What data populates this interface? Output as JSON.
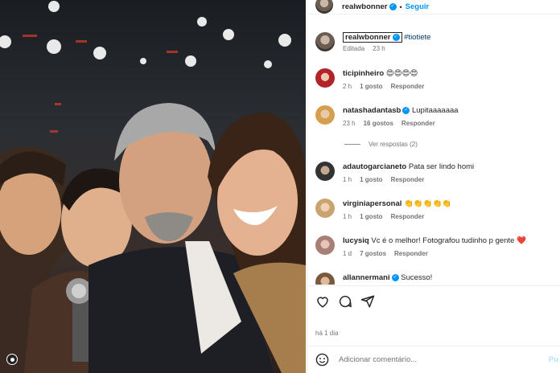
{
  "header": {
    "username": "realwbonner",
    "separator": "•",
    "follow_label": "Seguir"
  },
  "caption": {
    "username": "realwbonner",
    "text": "#tiotiete",
    "edited": "Editada",
    "age": "23 h"
  },
  "comments": [
    {
      "username": "ticipinheiro",
      "verified": false,
      "text": "😍😍😍😍",
      "age": "2 h",
      "likes": "1 gosto",
      "reply": "Responder"
    },
    {
      "username": "natashadantasb",
      "verified": true,
      "text": "Lupitaaaaaaa",
      "age": "23 h",
      "likes": "16 gostos",
      "reply": "Responder",
      "view_replies": "Ver respostas (2)"
    },
    {
      "username": "adautogarcianeto",
      "verified": false,
      "text": "Pata ser lindo homi",
      "age": "1 h",
      "likes": "1 gosto",
      "reply": "Responder"
    },
    {
      "username": "virginiapersonal",
      "verified": false,
      "text": "👏👏👏👏👏",
      "age": "1 h",
      "likes": "1 gosto",
      "reply": "Responder"
    },
    {
      "username": "lucysiq",
      "verified": false,
      "text": "Vc é o melhor! Fotografou tudinho p gente ",
      "heart": "❤️",
      "age": "1 d",
      "likes": "7 gostos",
      "reply": "Responder"
    },
    {
      "username": "allannermani",
      "verified": true,
      "text": "Sucesso!"
    }
  ],
  "post_age": "há 1 dia",
  "add_comment": {
    "placeholder": "Adicionar comentário...",
    "post_label": "Pu"
  },
  "icons": {
    "like": "heart-icon",
    "comment": "comment-icon",
    "share": "share-icon",
    "emoji": "emoji-icon",
    "verified": "verified-badge-icon"
  },
  "colors": {
    "link": "#0095f6",
    "muted": "#737373",
    "hashtag": "#00376b"
  }
}
